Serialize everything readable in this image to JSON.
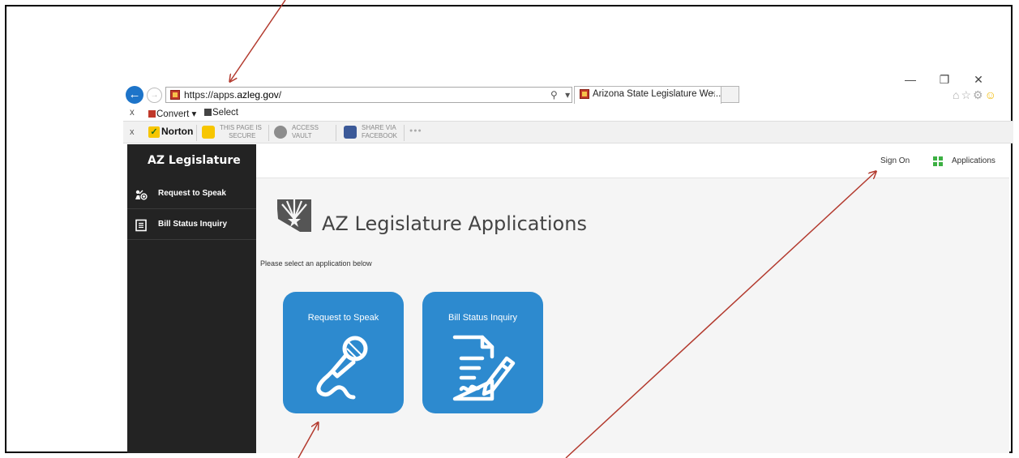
{
  "browser": {
    "url_prefix": "https://apps.",
    "url_host": "azleg.gov",
    "url_suffix": "/",
    "address_icons": "⚲ ▾ 🔒 ↻",
    "tab_title": "Arizona State Legislature We...",
    "tab_close": "×",
    "window_controls": [
      "—",
      "❐",
      "✕"
    ],
    "toolbar_icons": [
      "⌂",
      "☆",
      "⚙",
      "☺"
    ]
  },
  "command_bar": {
    "close": "x",
    "convert_label": "Convert",
    "convert_caret": "▾",
    "select_label": "Select"
  },
  "norton_bar": {
    "close": "x",
    "logo_label": "Norton",
    "logo_check": "✓",
    "items": [
      {
        "line1": "THIS PAGE IS",
        "line2": "SECURE"
      },
      {
        "line1": "ACCESS",
        "line2": "VAULT"
      },
      {
        "line1": "SHARE VIA",
        "line2": "FACEBOOK"
      }
    ],
    "more": "●●●"
  },
  "sidebar": {
    "brand": "AZ Legislature",
    "items": [
      {
        "label": "Request to Speak"
      },
      {
        "label": "Bill Status Inquiry"
      }
    ]
  },
  "topbar": {
    "sign_on": "Sign On",
    "applications": "Applications"
  },
  "main": {
    "title": "AZ Legislature Applications",
    "instruction": "Please select an application below",
    "tiles": [
      {
        "label": "Request to Speak"
      },
      {
        "label": "Bill Status Inquiry"
      }
    ]
  },
  "colors": {
    "sidebar_bg": "#232323",
    "tile_blue": "#2d8acf",
    "annotation_arrow": "#b33a2e"
  }
}
